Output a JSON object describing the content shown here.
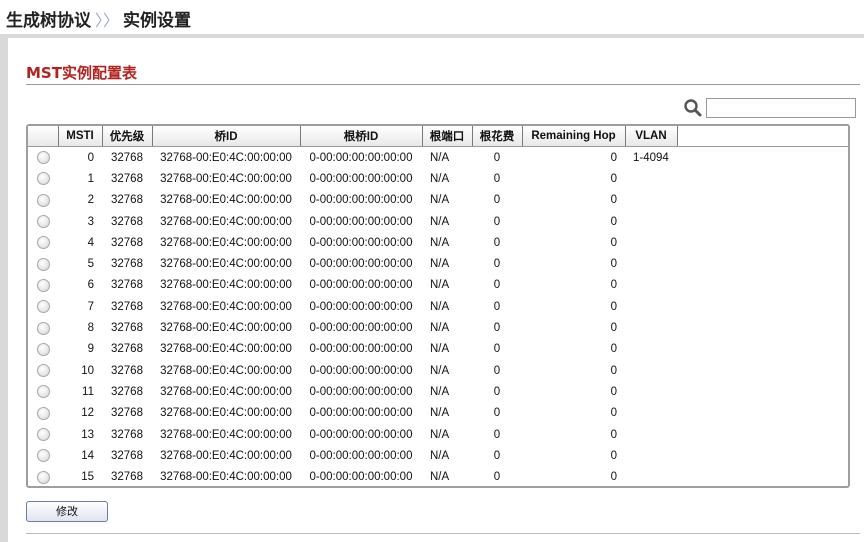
{
  "breadcrumb": {
    "parent": "生成树协议",
    "separator": "〉〉",
    "current": "实例设置"
  },
  "section": {
    "title": "MST实例配置表"
  },
  "search": {
    "icon": "search-icon",
    "value": "",
    "placeholder": ""
  },
  "table": {
    "columns": [
      "",
      "MSTI",
      "优先级",
      "桥ID",
      "根桥ID",
      "根端口",
      "根花费",
      "Remaining Hop",
      "VLAN"
    ],
    "rows": [
      {
        "msti": "0",
        "priority": "32768",
        "bridge_id": "32768-00:E0:4C:00:00:00",
        "root_bridge_id": "0-00:00:00:00:00:00",
        "root_port": "N/A",
        "root_cost": "0",
        "remaining_hop": "0",
        "vlan": "1-4094"
      },
      {
        "msti": "1",
        "priority": "32768",
        "bridge_id": "32768-00:E0:4C:00:00:00",
        "root_bridge_id": "0-00:00:00:00:00:00",
        "root_port": "N/A",
        "root_cost": "0",
        "remaining_hop": "0",
        "vlan": ""
      },
      {
        "msti": "2",
        "priority": "32768",
        "bridge_id": "32768-00:E0:4C:00:00:00",
        "root_bridge_id": "0-00:00:00:00:00:00",
        "root_port": "N/A",
        "root_cost": "0",
        "remaining_hop": "0",
        "vlan": ""
      },
      {
        "msti": "3",
        "priority": "32768",
        "bridge_id": "32768-00:E0:4C:00:00:00",
        "root_bridge_id": "0-00:00:00:00:00:00",
        "root_port": "N/A",
        "root_cost": "0",
        "remaining_hop": "0",
        "vlan": ""
      },
      {
        "msti": "4",
        "priority": "32768",
        "bridge_id": "32768-00:E0:4C:00:00:00",
        "root_bridge_id": "0-00:00:00:00:00:00",
        "root_port": "N/A",
        "root_cost": "0",
        "remaining_hop": "0",
        "vlan": ""
      },
      {
        "msti": "5",
        "priority": "32768",
        "bridge_id": "32768-00:E0:4C:00:00:00",
        "root_bridge_id": "0-00:00:00:00:00:00",
        "root_port": "N/A",
        "root_cost": "0",
        "remaining_hop": "0",
        "vlan": ""
      },
      {
        "msti": "6",
        "priority": "32768",
        "bridge_id": "32768-00:E0:4C:00:00:00",
        "root_bridge_id": "0-00:00:00:00:00:00",
        "root_port": "N/A",
        "root_cost": "0",
        "remaining_hop": "0",
        "vlan": ""
      },
      {
        "msti": "7",
        "priority": "32768",
        "bridge_id": "32768-00:E0:4C:00:00:00",
        "root_bridge_id": "0-00:00:00:00:00:00",
        "root_port": "N/A",
        "root_cost": "0",
        "remaining_hop": "0",
        "vlan": ""
      },
      {
        "msti": "8",
        "priority": "32768",
        "bridge_id": "32768-00:E0:4C:00:00:00",
        "root_bridge_id": "0-00:00:00:00:00:00",
        "root_port": "N/A",
        "root_cost": "0",
        "remaining_hop": "0",
        "vlan": ""
      },
      {
        "msti": "9",
        "priority": "32768",
        "bridge_id": "32768-00:E0:4C:00:00:00",
        "root_bridge_id": "0-00:00:00:00:00:00",
        "root_port": "N/A",
        "root_cost": "0",
        "remaining_hop": "0",
        "vlan": ""
      },
      {
        "msti": "10",
        "priority": "32768",
        "bridge_id": "32768-00:E0:4C:00:00:00",
        "root_bridge_id": "0-00:00:00:00:00:00",
        "root_port": "N/A",
        "root_cost": "0",
        "remaining_hop": "0",
        "vlan": ""
      },
      {
        "msti": "11",
        "priority": "32768",
        "bridge_id": "32768-00:E0:4C:00:00:00",
        "root_bridge_id": "0-00:00:00:00:00:00",
        "root_port": "N/A",
        "root_cost": "0",
        "remaining_hop": "0",
        "vlan": ""
      },
      {
        "msti": "12",
        "priority": "32768",
        "bridge_id": "32768-00:E0:4C:00:00:00",
        "root_bridge_id": "0-00:00:00:00:00:00",
        "root_port": "N/A",
        "root_cost": "0",
        "remaining_hop": "0",
        "vlan": ""
      },
      {
        "msti": "13",
        "priority": "32768",
        "bridge_id": "32768-00:E0:4C:00:00:00",
        "root_bridge_id": "0-00:00:00:00:00:00",
        "root_port": "N/A",
        "root_cost": "0",
        "remaining_hop": "0",
        "vlan": ""
      },
      {
        "msti": "14",
        "priority": "32768",
        "bridge_id": "32768-00:E0:4C:00:00:00",
        "root_bridge_id": "0-00:00:00:00:00:00",
        "root_port": "N/A",
        "root_cost": "0",
        "remaining_hop": "0",
        "vlan": ""
      },
      {
        "msti": "15",
        "priority": "32768",
        "bridge_id": "32768-00:E0:4C:00:00:00",
        "root_bridge_id": "0-00:00:00:00:00:00",
        "root_port": "N/A",
        "root_cost": "0",
        "remaining_hop": "0",
        "vlan": ""
      }
    ]
  },
  "actions": {
    "edit_label": "修改"
  }
}
